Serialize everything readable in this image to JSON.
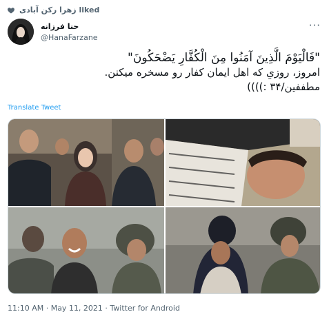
{
  "social_context": {
    "text": "زهرا رکن آبادی liked",
    "icon": "heart-icon"
  },
  "author": {
    "display_name": "حنا فرزانه",
    "handle": "@HanaFarzane",
    "avatar": "avatar-image"
  },
  "more_icon": "···",
  "tweet": {
    "line1": "\"فَالْيَوْمَ الَّذِينَ آمَنُوا مِنَ الْكُفَّارِ يَضْحَكُونَ\"",
    "line2": "امروز، روزیِ که اهل ایمان کفار رو مسخره میکنن.",
    "line3": "مطففین/۳۴ :))))"
  },
  "translate_label": "Translate Tweet",
  "meta": {
    "timestamp": "11:10 AM · May 11, 2021 · Twitter for Android"
  },
  "colors": {
    "accent": "#1d9bf0",
    "secondary": "#536471",
    "text": "#0f1419"
  }
}
